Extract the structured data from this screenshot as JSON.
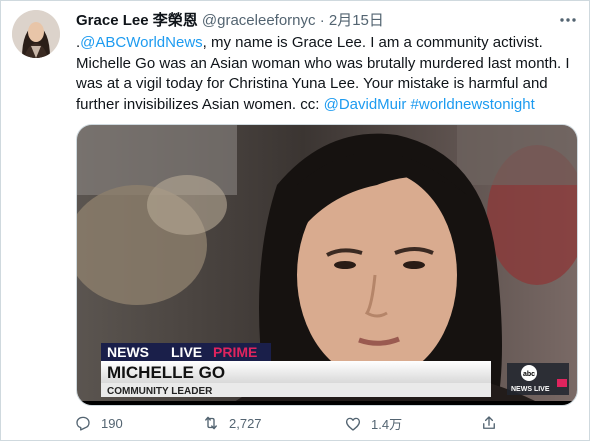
{
  "tweet": {
    "author_name": "Grace Lee 李榮恩",
    "handle": "@graceleefornyc",
    "separator": "·",
    "date": "2月15日",
    "text": {
      "prefix": ".",
      "mention1": "@ABCWorldNews",
      "body": ", my name is Grace Lee. I am a community activist. Michelle Go was an Asian woman who was brutally murdered last month. I was at a vigil today for Christina Yuna Lee. Your mistake is harmful and further invisibilizes Asian women. cc: ",
      "mention2": "@DavidMuir",
      "hashtag": "#worldnewstonight"
    }
  },
  "media": {
    "banner_network": "NEWS",
    "banner_live": "LIVE",
    "banner_prime": "PRIME",
    "lower_third_name": "MICHELLE GO",
    "lower_third_title": "COMMUNITY LEADER",
    "corner_logo": "abc",
    "corner_label": "NEWS LIVE"
  },
  "actions": {
    "replies": "190",
    "retweets": "2,727",
    "likes": "1.4万"
  }
}
